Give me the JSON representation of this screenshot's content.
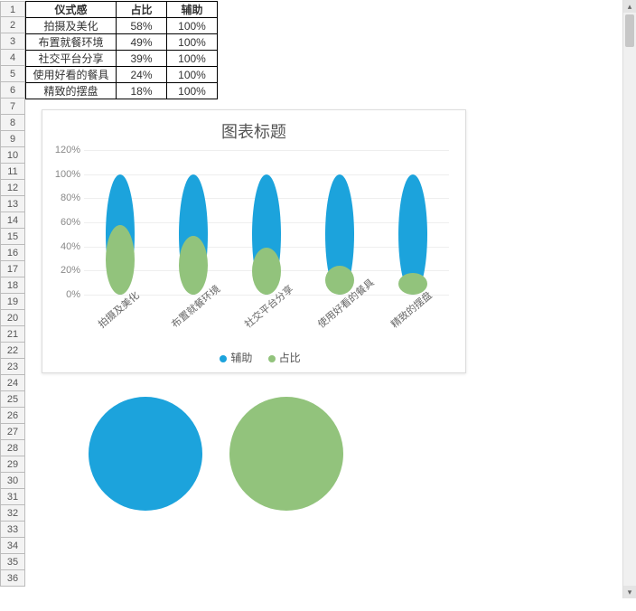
{
  "table": {
    "headers": [
      "仪式感",
      "占比",
      "辅助"
    ],
    "rows": [
      {
        "cat": "拍摄及美化",
        "pct": "58%",
        "aux": "100%"
      },
      {
        "cat": "布置就餐环境",
        "pct": "49%",
        "aux": "100%"
      },
      {
        "cat": "社交平台分享",
        "pct": "39%",
        "aux": "100%"
      },
      {
        "cat": "使用好看的餐具",
        "pct": "24%",
        "aux": "100%"
      },
      {
        "cat": "精致的摆盘",
        "pct": "18%",
        "aux": "100%"
      }
    ]
  },
  "row_numbers": [
    "1",
    "2",
    "3",
    "4",
    "5",
    "6",
    "7",
    "8",
    "9",
    "10",
    "11",
    "12",
    "13",
    "14",
    "15",
    "16",
    "17",
    "18",
    "19",
    "20",
    "21",
    "22",
    "23",
    "24",
    "25",
    "26",
    "27",
    "28",
    "29",
    "30",
    "31",
    "32",
    "33",
    "34",
    "35",
    "36"
  ],
  "chart_data": {
    "type": "bar",
    "title": "图表标题",
    "categories": [
      "拍摄及美化",
      "布置就餐环境",
      "社交平台分享",
      "使用好看的餐具",
      "精致的摆盘"
    ],
    "series": [
      {
        "name": "辅助",
        "values": [
          100,
          100,
          100,
          100,
          100
        ],
        "color": "#1ca3dc"
      },
      {
        "name": "占比",
        "values": [
          58,
          49,
          39,
          24,
          18
        ],
        "color": "#92c37c"
      }
    ],
    "y_ticks": [
      0,
      20,
      40,
      60,
      80,
      100,
      120
    ],
    "ylim": [
      0,
      120
    ],
    "xlabel": "",
    "ylabel": "",
    "legend_position": "bottom"
  },
  "shapes": {
    "circle1_color": "#1ca3dc",
    "circle2_color": "#92c37c"
  },
  "scrollbar": {
    "up": "▴",
    "down": "▾"
  }
}
